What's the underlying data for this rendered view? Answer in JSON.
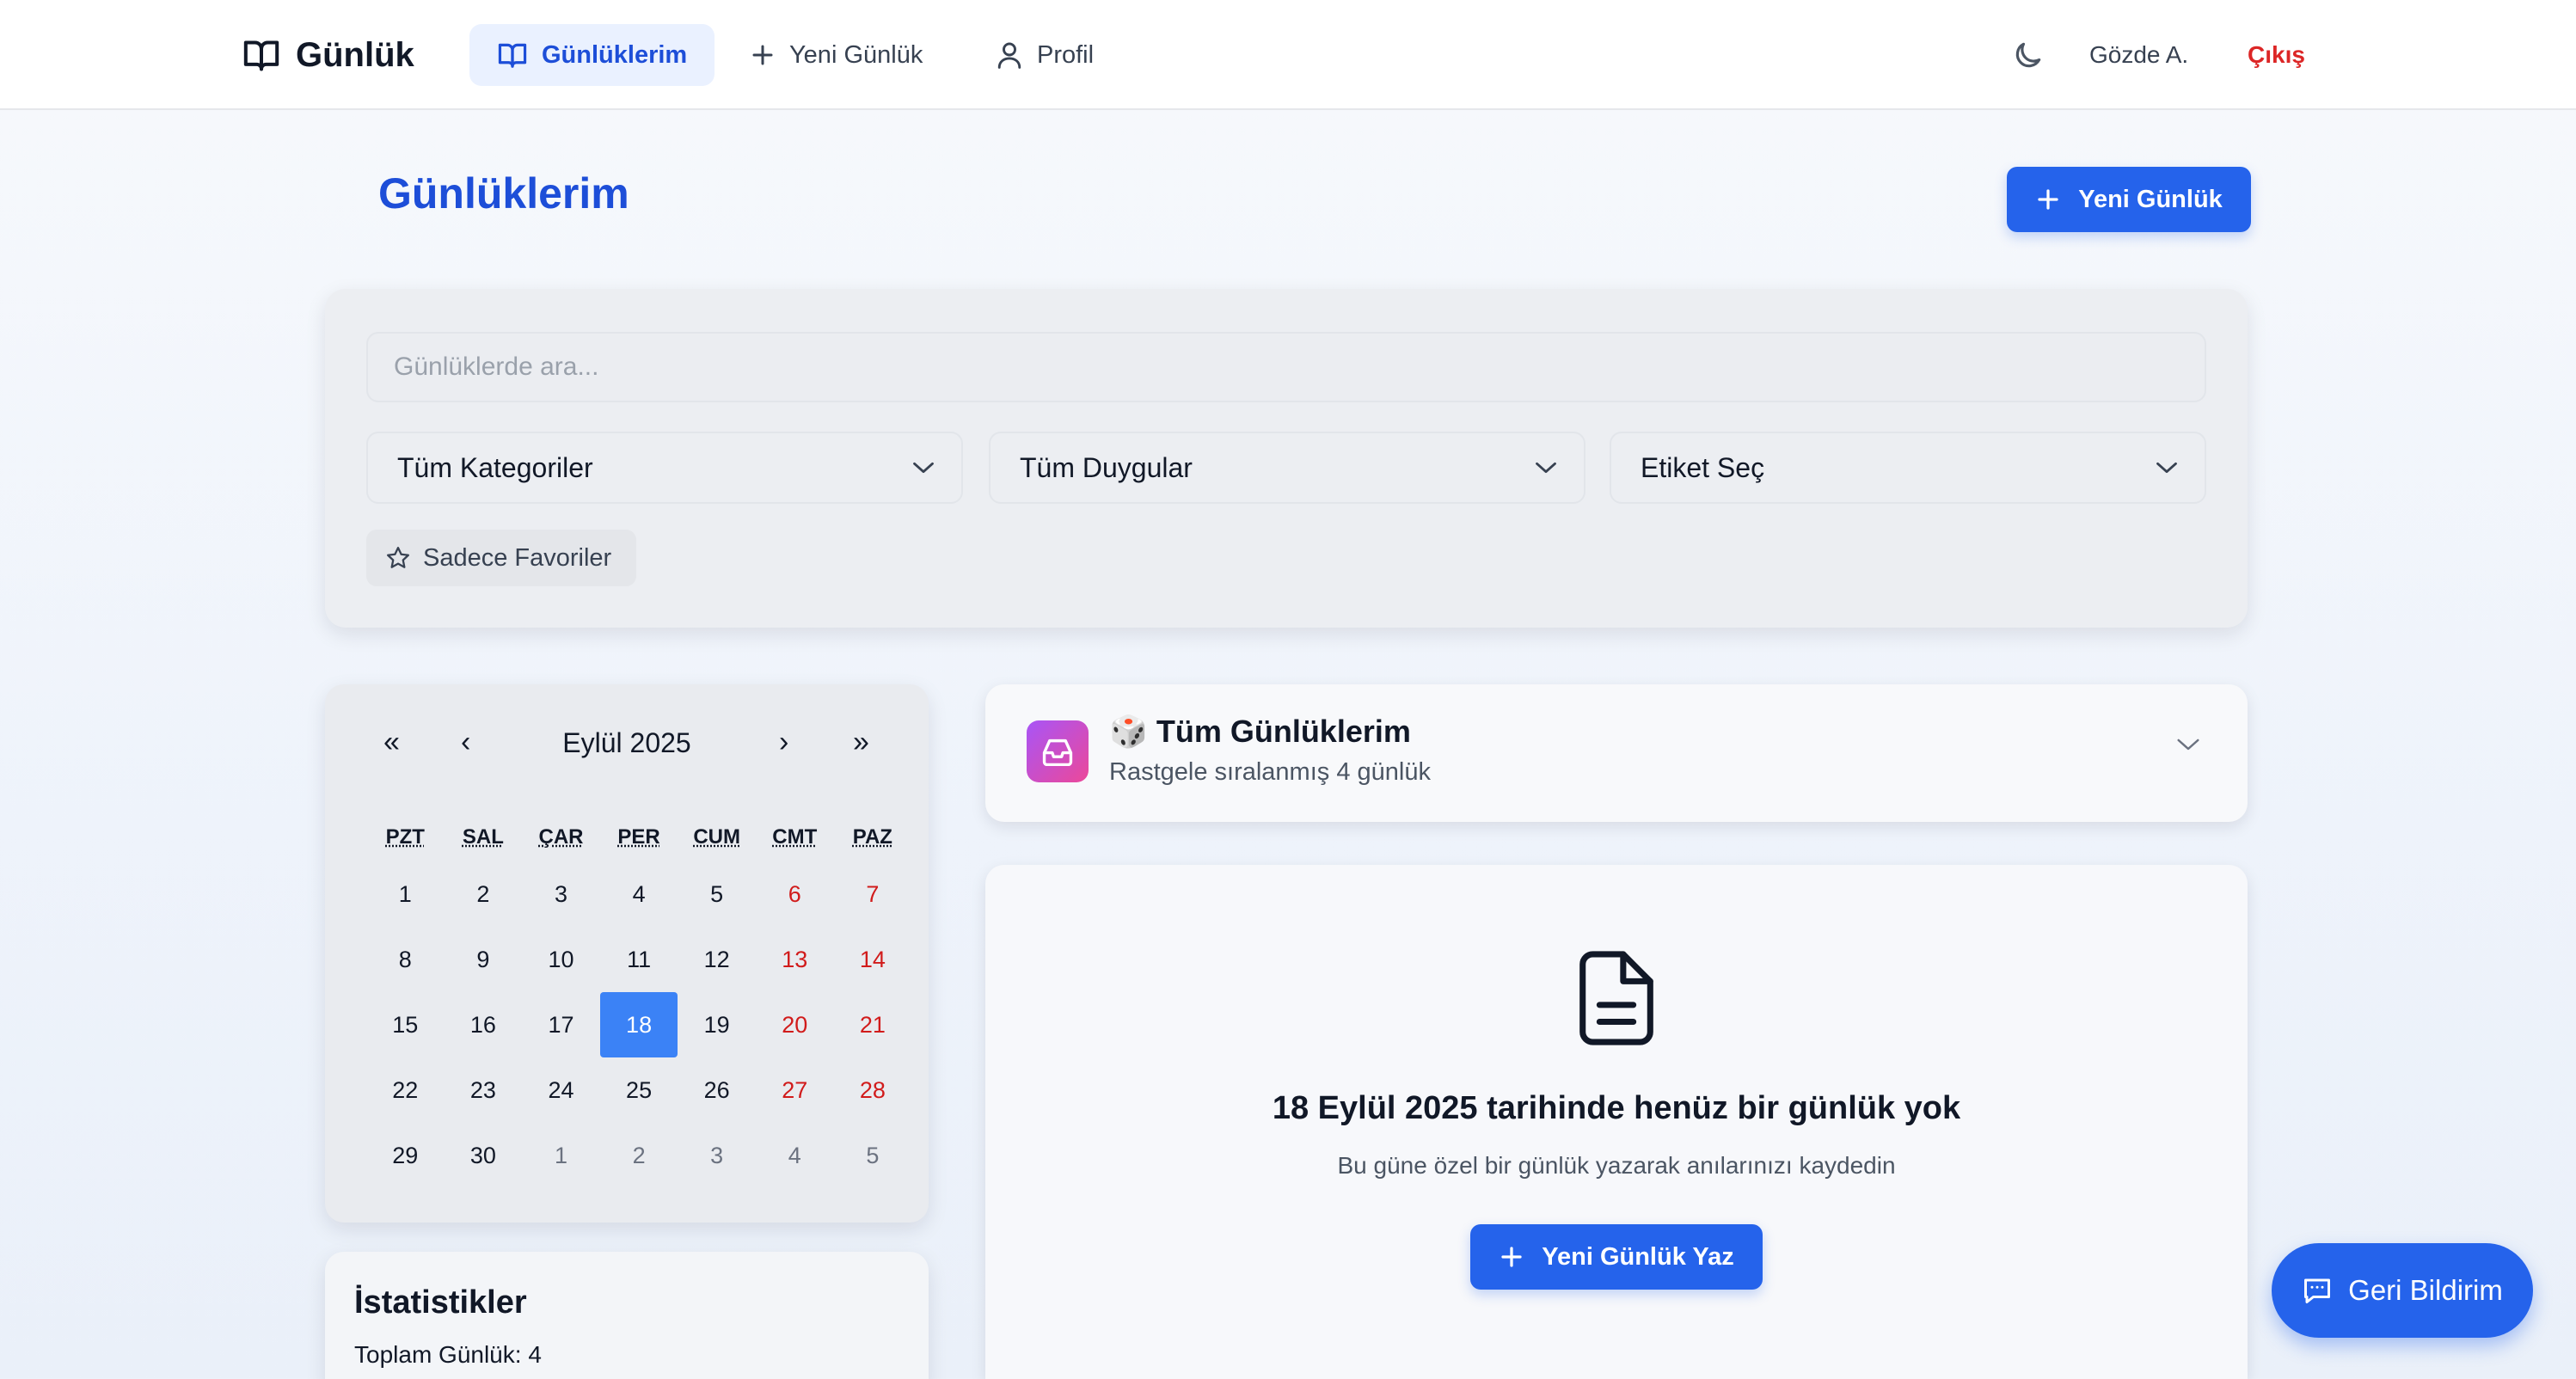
{
  "nav": {
    "brand": "Günlük",
    "items": [
      {
        "label": "Günlüklerim",
        "icon": "book-open-icon"
      },
      {
        "label": "Yeni Günlük",
        "icon": "plus-icon"
      },
      {
        "label": "Profil",
        "icon": "user-icon"
      }
    ],
    "user": "Gözde A.",
    "logout": "Çıkış"
  },
  "header": {
    "title": "Günlüklerim",
    "new_button": "Yeni Günlük"
  },
  "filters": {
    "search_placeholder": "Günlüklerde ara...",
    "category": "Tüm Kategoriler",
    "mood": "Tüm Duygular",
    "tag": "Etiket Seç",
    "favorites": "Sadece Favoriler"
  },
  "calendar": {
    "title": "Eylül 2025",
    "nav": {
      "prev_year": "«",
      "prev_month": "‹",
      "next_month": "›",
      "next_year": "»"
    },
    "weekdays": [
      "PZT",
      "SAL",
      "ÇAR",
      "PER",
      "CUM",
      "CMT",
      "PAZ"
    ],
    "weeks": [
      [
        "1",
        "2",
        "3",
        "4",
        "5",
        "6",
        "7"
      ],
      [
        "8",
        "9",
        "10",
        "11",
        "12",
        "13",
        "14"
      ],
      [
        "15",
        "16",
        "17",
        "18",
        "19",
        "20",
        "21"
      ],
      [
        "22",
        "23",
        "24",
        "25",
        "26",
        "27",
        "28"
      ],
      [
        "29",
        "30",
        "1",
        "2",
        "3",
        "4",
        "5"
      ]
    ],
    "selected": "18",
    "weekend_color": "#d11b1b",
    "selected_color": "#3b82f6"
  },
  "stats": {
    "title": "İstatistikler",
    "total": "Toplam Günlük: 4"
  },
  "entries": {
    "emoji": "🎲",
    "title": "Tüm Günlüklerim",
    "subtitle": "Rastgele sıralanmış 4 günlük"
  },
  "empty_state": {
    "title": "18 Eylül 2025 tarihinde henüz bir günlük yok",
    "subtitle": "Bu güne özel bir günlük yazarak anılarınızı kaydedin",
    "button": "Yeni Günlük Yaz"
  },
  "feedback": {
    "label": "Geri Bildirim"
  },
  "colors": {
    "primary": "#2563eb",
    "title_blue": "#1d4ed8",
    "danger": "#dc2626"
  }
}
